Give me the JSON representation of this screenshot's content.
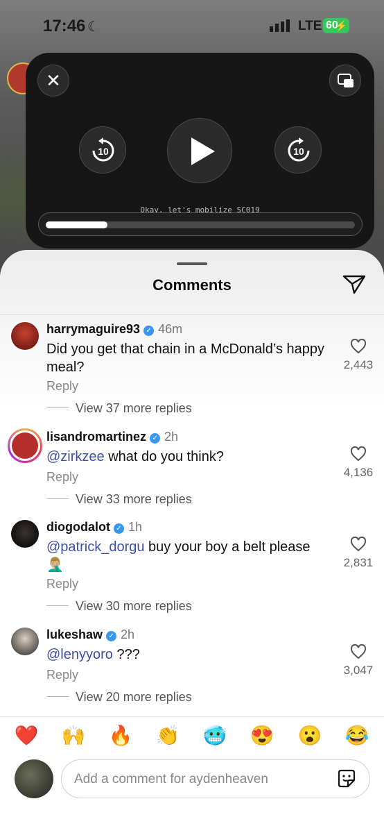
{
  "status_bar": {
    "time": "17:46",
    "network": "LTE",
    "battery": "60"
  },
  "player": {
    "subtitle": "Okay, let's mobilize SC019",
    "skip_back_seconds": "10",
    "skip_forward_seconds": "10",
    "progress": 0.2
  },
  "sheet": {
    "title": "Comments"
  },
  "comments": [
    {
      "username": "harrymaguire93",
      "time": "46m",
      "parts": [
        "",
        "Did you get that chain in a McDonald’s happy meal?"
      ],
      "reply": "Reply",
      "more": "View 37 more replies",
      "likes": "2,443"
    },
    {
      "username": "lisandromartinez",
      "time": "2h",
      "parts": [
        "@zirkzee",
        " what do you think?"
      ],
      "reply": "Reply",
      "more": "View 33 more replies",
      "likes": "4,136"
    },
    {
      "username": "diogodalot",
      "time": "1h",
      "parts": [
        "@patrick_dorgu",
        " buy your boy a belt please 🤦🏼‍♂️"
      ],
      "reply": "Reply",
      "more": "View 30 more replies",
      "likes": "2,831"
    },
    {
      "username": "lukeshaw",
      "time": "2h",
      "parts": [
        "@lenyyoro",
        " ???"
      ],
      "reply": "Reply",
      "more": "View 20 more replies",
      "likes": "3,047"
    }
  ],
  "emoji_bar": [
    "❤️",
    "🙌",
    "🔥",
    "👏",
    "🥶",
    "😍",
    "😮",
    "😂"
  ],
  "composer": {
    "placeholder": "Add a comment for aydenheaven"
  },
  "colors": {
    "verified": "#3897f0",
    "mention": "#3b4fa8",
    "battery": "#34c759"
  }
}
